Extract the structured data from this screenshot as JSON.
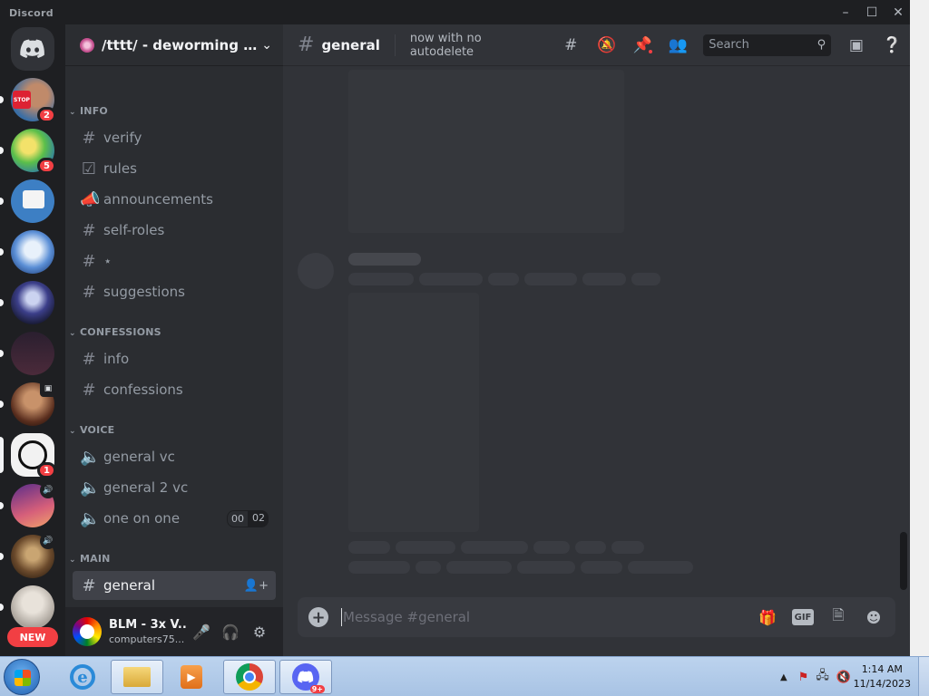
{
  "window": {
    "title": "Discord"
  },
  "rail": {
    "servers": [
      {
        "badge": "2",
        "speaker": false
      },
      {
        "badge": "5",
        "speaker": false
      },
      {
        "badge": "",
        "speaker": false
      },
      {
        "badge": "",
        "speaker": false
      },
      {
        "badge": "",
        "speaker": false
      },
      {
        "badge": "",
        "speaker": false
      },
      {
        "badge": "",
        "speaker": false
      },
      {
        "badge": "1",
        "speaker": false
      },
      {
        "badge": "",
        "speaker": true
      },
      {
        "badge": "",
        "speaker": true
      },
      {
        "badge": "",
        "speaker": false
      }
    ],
    "new_label": "NEW"
  },
  "guild": {
    "name": "/tttt/ - deworming cli..."
  },
  "categories": {
    "info": "INFO",
    "confessions": "CONFESSIONS",
    "voice": "VOICE",
    "main": "MAIN"
  },
  "channels": {
    "info": [
      "verify",
      "rules",
      "announcements",
      "self-roles",
      "⋆",
      "suggestions"
    ],
    "confessions": [
      "info",
      "confessions"
    ],
    "voice": [
      "general vc",
      "general 2 vc",
      "one on one"
    ],
    "main": [
      "general"
    ]
  },
  "voice_counter": {
    "current": "00",
    "limit": "02"
  },
  "user": {
    "name": "BLM - 3x V...",
    "subtext": "computers75..."
  },
  "header": {
    "channel": "general",
    "topic": "now with no autodelete",
    "search_placeholder": "Search"
  },
  "composer": {
    "placeholder": "Message #general",
    "gif_label": "GIF"
  },
  "taskbar": {
    "time": "1:14 AM",
    "date": "11/14/2023",
    "discord_badge": "9+"
  },
  "colors": {
    "accent": "#5865f2",
    "danger": "#f23f43",
    "sidebar": "#2b2d31",
    "main": "#313338"
  }
}
